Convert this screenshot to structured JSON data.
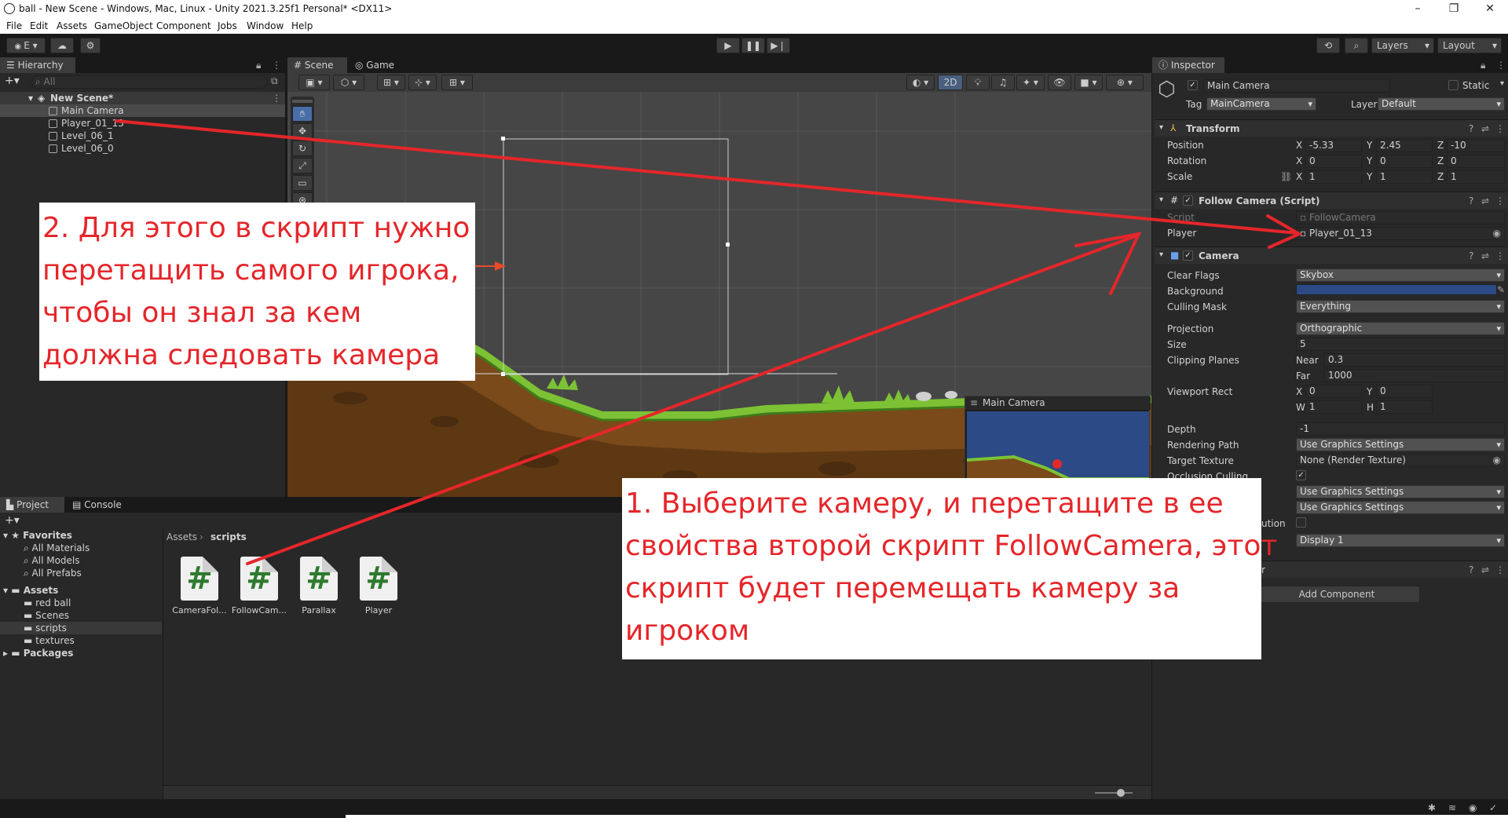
{
  "window": {
    "title": "ball - New Scene - Windows, Mac, Linux - Unity 2021.3.25f1 Personal* <DX11>",
    "controls": [
      "–",
      "❐",
      "✕"
    ]
  },
  "menu": [
    "File",
    "Edit",
    "Assets",
    "GameObject",
    "Component",
    "Jobs",
    "Window",
    "Help"
  ],
  "toolbar": {
    "account_label": "E",
    "layers_label": "Layers",
    "layout_label": "Layout"
  },
  "hierarchy": {
    "tab": "Hierarchy",
    "search_placeholder": "All",
    "scene": "New Scene*",
    "items": [
      "Main Camera",
      "Player_01_13",
      "Level_06_1",
      "Level_06_0"
    ]
  },
  "scene_view": {
    "tabs": [
      "Scene",
      "Game"
    ],
    "mode_2d": "2D",
    "camera_preview_title": "Main Camera"
  },
  "project": {
    "tabs": [
      "Project",
      "Console"
    ],
    "favorites_title": "Favorites",
    "favorites": [
      "All Materials",
      "All Models",
      "All Prefabs"
    ],
    "assets_title": "Assets",
    "folders": [
      "red ball",
      "Scenes",
      "scripts",
      "textures"
    ],
    "packages_title": "Packages",
    "breadcrumb": [
      "Assets",
      "scripts"
    ],
    "files": [
      "CameraFol...",
      "FollowCam...",
      "Parallax",
      "Player"
    ]
  },
  "inspector": {
    "tab": "Inspector",
    "object_name": "Main Camera",
    "static_label": "Static",
    "tag_label": "Tag",
    "tag_value": "MainCamera",
    "layer_label": "Layer",
    "layer_value": "Default",
    "transform": {
      "title": "Transform",
      "position_label": "Position",
      "rotation_label": "Rotation",
      "scale_label": "Scale",
      "position": [
        "-5.33",
        "2.45",
        "-10"
      ],
      "rotation": [
        "0",
        "0",
        "0"
      ],
      "scale": [
        "1",
        "1",
        "1"
      ]
    },
    "follow": {
      "title": "Follow Camera (Script)",
      "script_label": "Script",
      "script_value": "FollowCamera",
      "player_label": "Player",
      "player_value": "Player_01_13"
    },
    "camera": {
      "title": "Camera",
      "clear_flags_label": "Clear Flags",
      "clear_flags": "Skybox",
      "background_label": "Background",
      "background_color": "#2b4a86",
      "culling_mask_label": "Culling Mask",
      "culling_mask": "Everything",
      "projection_label": "Projection",
      "projection": "Orthographic",
      "size_label": "Size",
      "size": "5",
      "clipping_label": "Clipping Planes",
      "near_label": "Near",
      "near": "0.3",
      "far_label": "Far",
      "far": "1000",
      "viewport_label": "Viewport Rect",
      "vp_x": "0",
      "vp_y": "0",
      "vp_w": "1",
      "vp_h": "1",
      "depth_label": "Depth",
      "depth": "-1",
      "rendering_path_label": "Rendering Path",
      "rendering_path": "Use Graphics Settings",
      "target_texture_label": "Target Texture",
      "target_texture": "None (Render Texture)",
      "occlusion_label": "Occlusion Culling",
      "hdr": "Use Graphics Settings",
      "msaa": "Use Graphics Settings",
      "partial_label": "ution",
      "display": "Display 1",
      "partial_component": "r"
    },
    "add_component": "Add Component"
  },
  "annotations": {
    "callout_2": [
      "2. Для этого в скрипт нужно",
      "перетащить самого игрока,",
      "чтобы он знал за кем",
      "должна следовать камера"
    ],
    "callout_1": [
      "1. Выберите камеру, и перетащите в ее",
      "свойства второй скрипт FollowCamera, этот",
      "скрипт будет перемещать камеру за",
      "игроком"
    ],
    "arrow_color": "#e5262a"
  },
  "colors": {
    "editor_bg": "#282828",
    "scene_bg": "#464646",
    "dirt": "#7a4a1a",
    "grass": "#7cc234",
    "ball": "#e02a2a"
  }
}
